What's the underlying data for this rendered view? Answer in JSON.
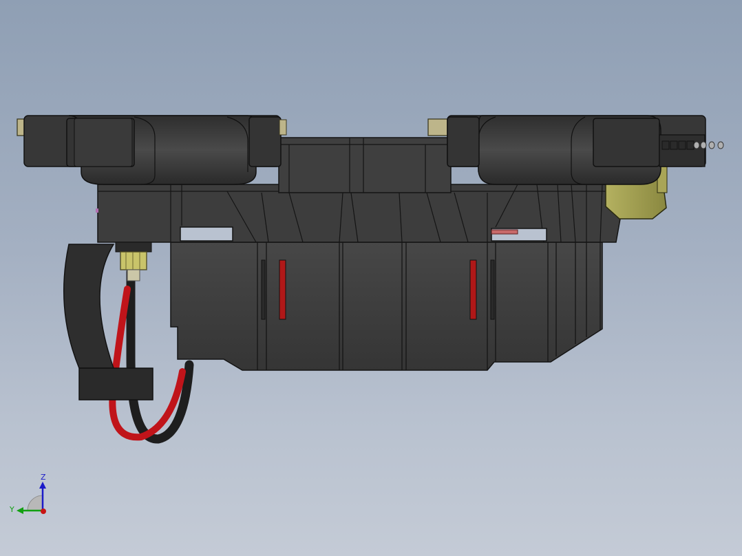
{
  "viewport": {
    "background_top": "#8f9fb4",
    "background_bottom": "#c4cbd6"
  },
  "model": {
    "body_color": "#3c3c3c",
    "edge_color": "#141414",
    "tan_color": "#bdb58a",
    "olive_color": "#9a9850",
    "wire_red": "#c0141a",
    "wire_black": "#1e1e1e",
    "brass_color": "#c9c46a",
    "slot_red": "#b01818"
  },
  "triad": {
    "z_label": "Z",
    "y_label": "Y",
    "z_color": "#1a1ac8",
    "y_color": "#12a012",
    "x_color": "#c81414"
  }
}
